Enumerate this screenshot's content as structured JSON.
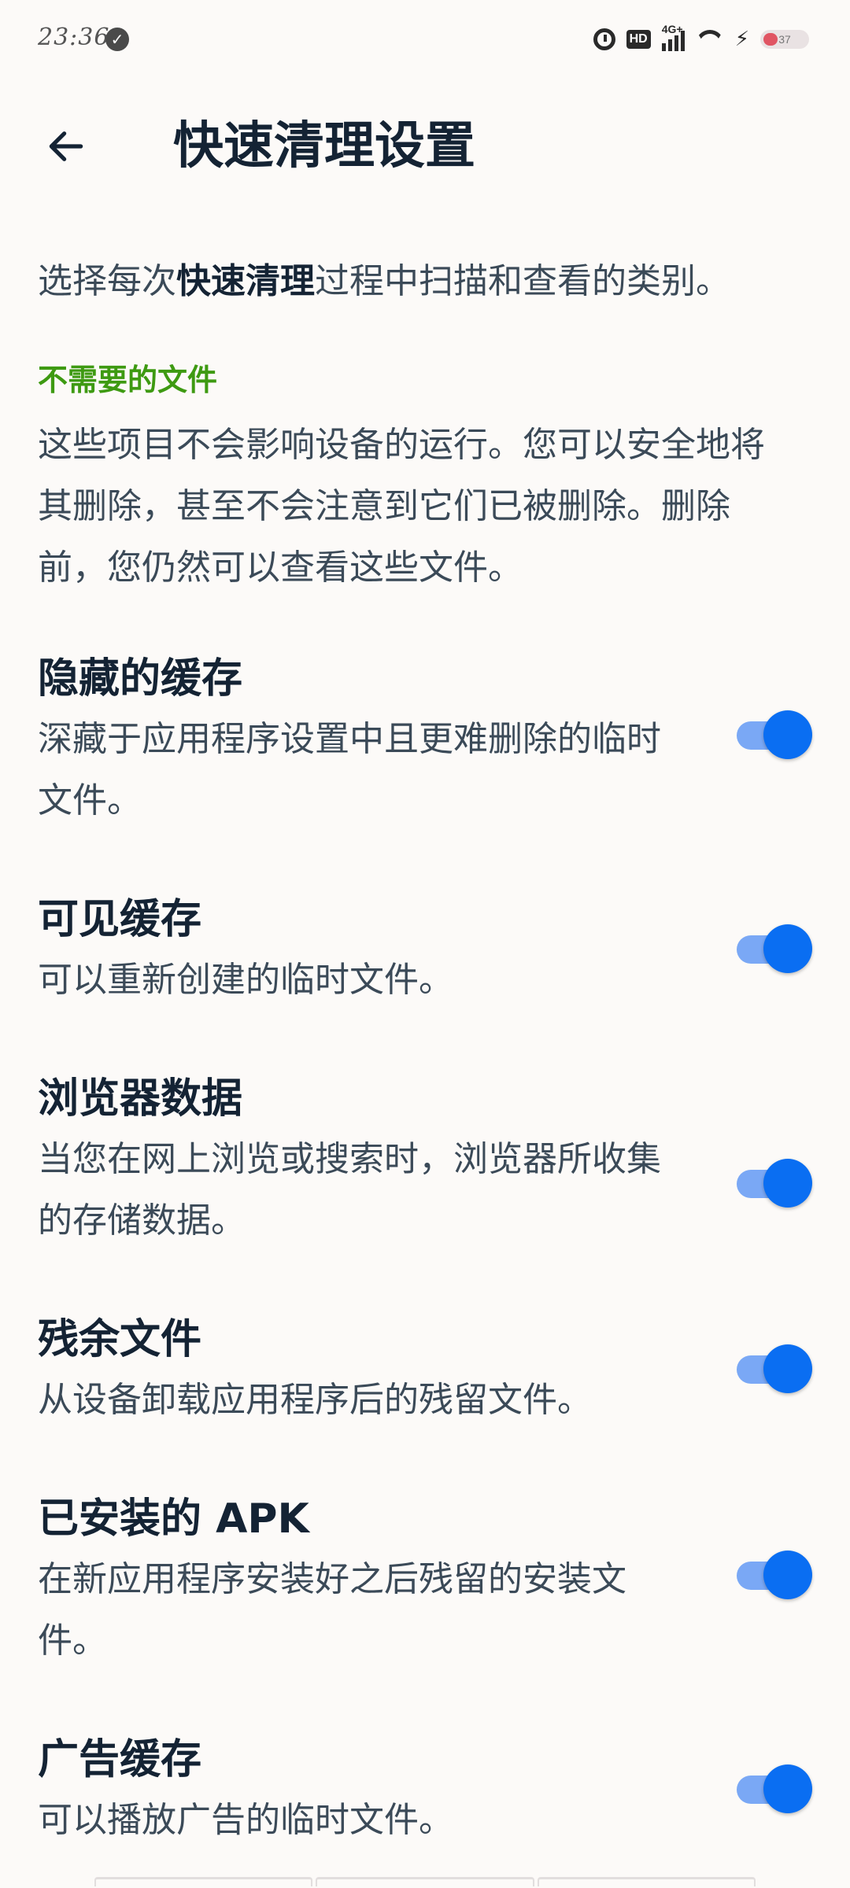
{
  "status_bar": {
    "time": "23:36",
    "network_label": "4G+",
    "hd_label": "HD",
    "battery_level": "37",
    "icons": [
      "check-circle-icon",
      "alarm-icon",
      "hd-icon",
      "signal-icon",
      "wifi-icon",
      "charging-icon",
      "battery-icon"
    ]
  },
  "header": {
    "title": "快速清理设置",
    "back_icon": "arrow-left-icon"
  },
  "intro": {
    "prefix": "选择每次",
    "bold": "快速清理",
    "suffix": "过程中扫描和查看的类别。"
  },
  "section": {
    "label": "不需要的文件",
    "description": "这些项目不会影响设备的运行。您可以安全地将其删除，甚至不会注意到它们已被删除。删除前，您仍然可以查看这些文件。",
    "label_color": "#3e9a12"
  },
  "settings": [
    {
      "title": "隐藏的缓存",
      "description": "深藏于应用程序设置中且更难删除的临时文件。",
      "enabled": true
    },
    {
      "title": "可见缓存",
      "description": "可以重新创建的临时文件。",
      "enabled": true
    },
    {
      "title": "浏览器数据",
      "description": "当您在网上浏览或搜索时，浏览器所收集的存储数据。",
      "enabled": true
    },
    {
      "title": "残余文件",
      "description": "从设备卸载应用程序后的残留文件。",
      "enabled": true
    },
    {
      "title": "已安装的 APK",
      "description": "在新应用程序安装好之后残留的安装文件。",
      "enabled": true
    },
    {
      "title": "广告缓存",
      "description": "可以播放广告的临时文件。",
      "enabled": true
    }
  ],
  "colors": {
    "accent": "#0a6ef2",
    "toggle_track": "#7aa8f5",
    "background": "#fcfaf8"
  }
}
